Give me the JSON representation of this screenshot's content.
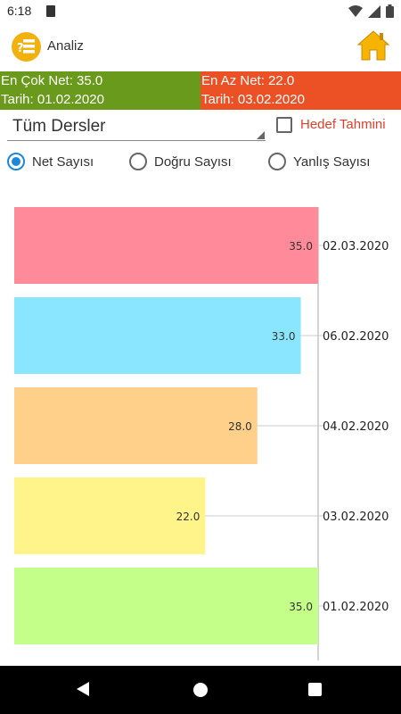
{
  "status_bar": {
    "time": "6:18"
  },
  "app_bar": {
    "title": "Analiz"
  },
  "banner": {
    "best_net": "En Çok Net: 35.0",
    "best_date": "Tarih: 01.02.2020",
    "worst_net": "En Az Net: 22.0",
    "worst_date": "Tarih: 03.02.2020",
    "best_color": "#6a9a1c",
    "worst_color": "#ec5125"
  },
  "filters": {
    "subject": "Tüm Dersler",
    "target_label": "Hedef Tahmini",
    "target_checked": false
  },
  "radios": [
    {
      "label": "Net Sayısı",
      "checked": true
    },
    {
      "label": "Doğru Sayısı",
      "checked": false
    },
    {
      "label": "Yanlış Sayısı",
      "checked": false
    }
  ],
  "chart_data": {
    "type": "bar",
    "orientation": "horizontal",
    "categories": [
      "02.03.2020",
      "06.02.2020",
      "04.02.2020",
      "03.02.2020",
      "01.02.2020"
    ],
    "values": [
      35.0,
      33.0,
      28.0,
      22.0,
      35.0
    ],
    "value_labels": [
      "35.0",
      "33.0",
      "28.0",
      "22.0",
      "35.0"
    ],
    "colors": [
      "#ff8a9a",
      "#8ae6fe",
      "#ffd08a",
      "#fff48a",
      "#c4ff8a"
    ],
    "xlim": [
      0,
      35
    ],
    "grid": true,
    "title": "",
    "xlabel": "",
    "ylabel": ""
  }
}
